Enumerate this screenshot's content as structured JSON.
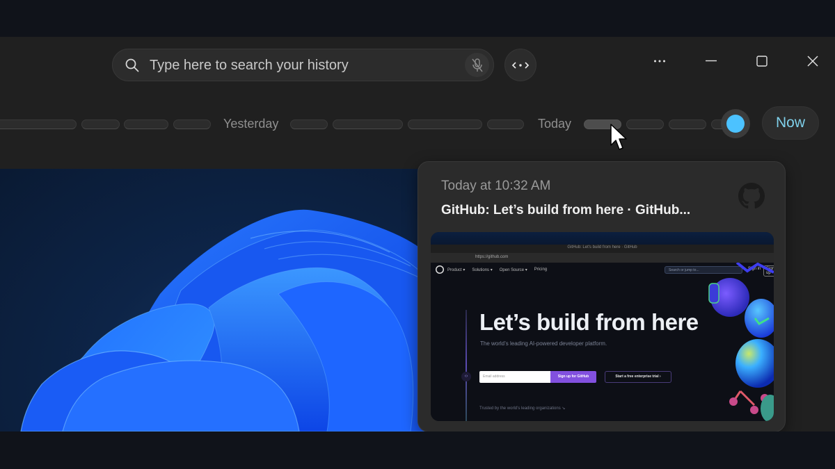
{
  "search": {
    "placeholder": "Type here to search your history",
    "value": "",
    "search_icon": "search-icon",
    "mic_icon": "mic-off-icon"
  },
  "toolbar": {
    "code_icon": "code-view-icon"
  },
  "window_controls": {
    "more": "more-options-icon",
    "minimize": "minimize-icon",
    "maximize": "maximize-icon",
    "close": "close-icon"
  },
  "timeline": {
    "labels": [
      "Yesterday",
      "Today"
    ],
    "yesterday_label": "Yesterday",
    "today_label": "Today",
    "now_label": "Now",
    "thumb_color": "#4cc2ff",
    "position": "now"
  },
  "preview_card": {
    "time": "Today at 10:32 AM",
    "title": "GitHub: Let’s build from here · GitHub...",
    "app_icon": "github-icon",
    "screenshot": {
      "window_title": "GitHub: Let's build from here · GitHub",
      "url": "https://github.com",
      "nav": [
        "Product ▾",
        "Solutions ▾",
        "Open Source ▾",
        "Pricing"
      ],
      "search_placeholder": "Search or jump to...",
      "sign_in": "Sign in",
      "sign_up": "Sign up",
      "hero": "Let’s build from here",
      "subtitle": "The world’s leading AI-powered developer platform.",
      "email_placeholder": "Email address",
      "cta": "Sign up for GitHub",
      "trial": "Start a free enterprise trial ›",
      "trusted": "Trusted by the world’s leading organizations ↘"
    }
  },
  "colors": {
    "accent": "#4cc2ff",
    "now_text": "#7fd0ea",
    "window_bg": "#202020",
    "github_purple": "#8250df"
  }
}
